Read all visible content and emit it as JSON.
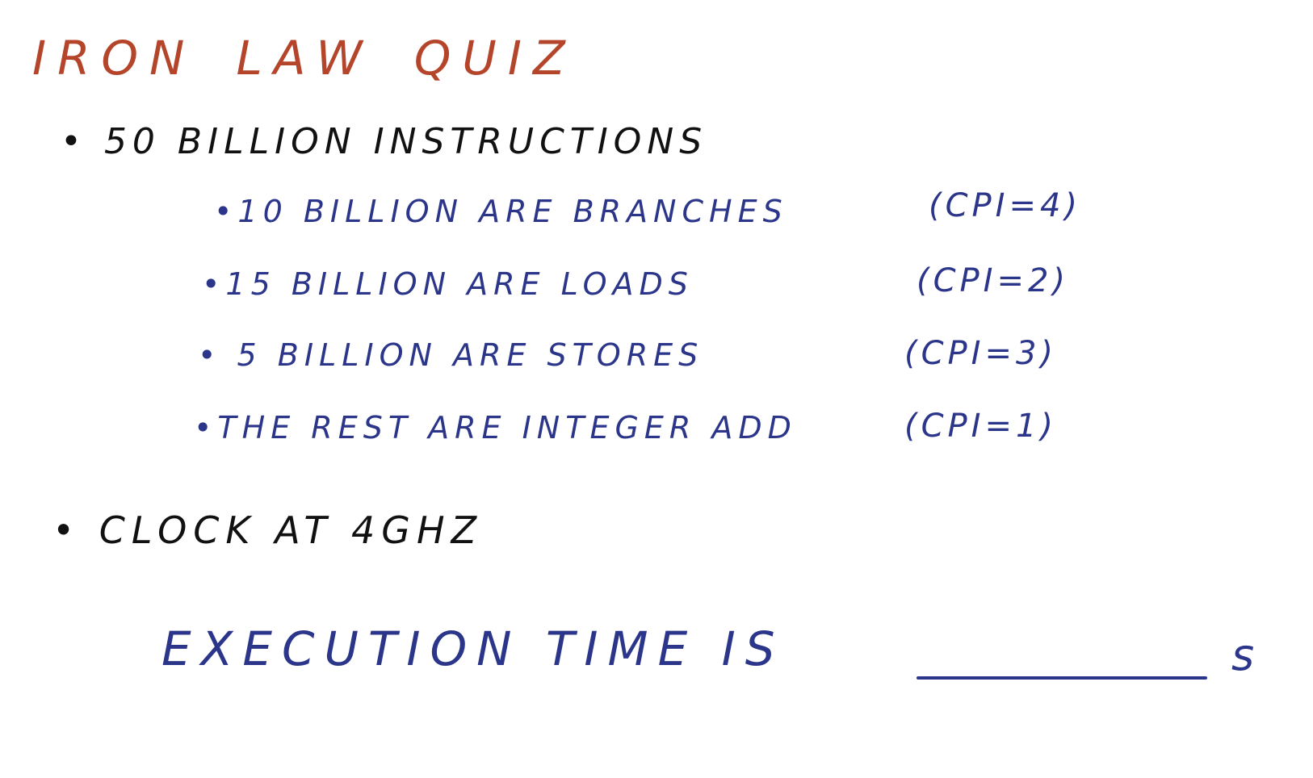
{
  "title": [
    "IRON",
    "LAW",
    "QUIZ"
  ],
  "bullet_main": "• 50 BILLION INSTRUCTIONS",
  "sub_bullets": [
    {
      "text": "•10 BILLION ARE BRANCHES",
      "cpi": "(CPI=4)"
    },
    {
      "text": "•15 BILLION ARE LOADS",
      "cpi": "(CPI=2)"
    },
    {
      "text": "• 5 BILLION ARE STORES",
      "cpi": "(CPI=3)"
    },
    {
      "text": "•THE REST ARE INTEGER ADD",
      "cpi": "(CPI=1)"
    }
  ],
  "clock": "• CLOCK AT 4GHz",
  "question": "EXECUTION TIME IS",
  "answer_value": "",
  "unit": "s",
  "colors": {
    "title": "#b5452a",
    "main": "#111111",
    "sub": "#2b358a"
  }
}
